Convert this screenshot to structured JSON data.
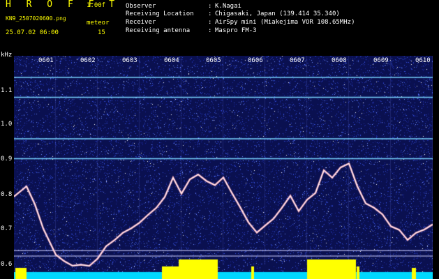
{
  "header": {
    "brand": "H R O F F T",
    "version": "1.00f",
    "filename": "KN9_2507020600.png",
    "counter_label": "meteor",
    "datetime": "25.07.02 06:00",
    "counter_value": "15"
  },
  "metadata": [
    {
      "label": "Observer",
      "value": "K.Nagai"
    },
    {
      "label": "Receiving Location",
      "value": "Chigasaki, Japan (139.414 35.340)"
    },
    {
      "label": "Receiver",
      "value": "AirSpy mini (Miakejima VOR 108.65MHz)"
    },
    {
      "label": "Receiving antenna",
      "value": "Maspro FM-3"
    }
  ],
  "colon": ":",
  "chart_data": {
    "type": "heatmap",
    "ylabel": "kHz",
    "y_ticks": [
      "1.1",
      "1.0",
      "0.9",
      "0.8",
      "0.7",
      "0.6"
    ],
    "x_ticks": [
      "0601",
      "0602",
      "0603",
      "0604",
      "0605",
      "0606",
      "0607",
      "0608",
      "0609",
      "0610"
    ],
    "ylim": [
      0.58,
      1.16
    ],
    "carrier_lines_khz": [
      1.1,
      1.045,
      0.93,
      0.875
    ],
    "trace": {
      "x_minutes": [
        0,
        0.3,
        0.5,
        0.7,
        1.0,
        1.2,
        1.4,
        1.6,
        1.8,
        2.0,
        2.2,
        2.4,
        2.6,
        2.8,
        3.0,
        3.2,
        3.4,
        3.6,
        3.8,
        4.0,
        4.2,
        4.4,
        4.6,
        4.8,
        5.0,
        5.2,
        5.4,
        5.6,
        5.8,
        6.0,
        6.2,
        6.4,
        6.6,
        6.8,
        7.0,
        7.2,
        7.4,
        7.6,
        7.8,
        8.0,
        8.2,
        8.4,
        8.6,
        8.8,
        9.0,
        9.2,
        9.4,
        9.6,
        9.8,
        10.0
      ],
      "y_khz": [
        0.77,
        0.8,
        0.75,
        0.68,
        0.61,
        0.59,
        0.58,
        0.58,
        0.58,
        0.6,
        0.63,
        0.65,
        0.67,
        0.68,
        0.7,
        0.72,
        0.74,
        0.77,
        0.82,
        0.78,
        0.82,
        0.83,
        0.81,
        0.8,
        0.82,
        0.78,
        0.74,
        0.7,
        0.67,
        0.69,
        0.71,
        0.74,
        0.77,
        0.73,
        0.76,
        0.78,
        0.84,
        0.82,
        0.85,
        0.86,
        0.8,
        0.75,
        0.74,
        0.72,
        0.69,
        0.68,
        0.65,
        0.67,
        0.68,
        0.69
      ]
    },
    "colors": {
      "background": "#000000",
      "noise_low": "#101a7a",
      "noise_high": "#4a6cff",
      "carrier": "#7ad4ff",
      "trace": "#ffb0c0",
      "bottom_band": "#00d8ff",
      "meteor_flash": "#ffff00"
    }
  }
}
